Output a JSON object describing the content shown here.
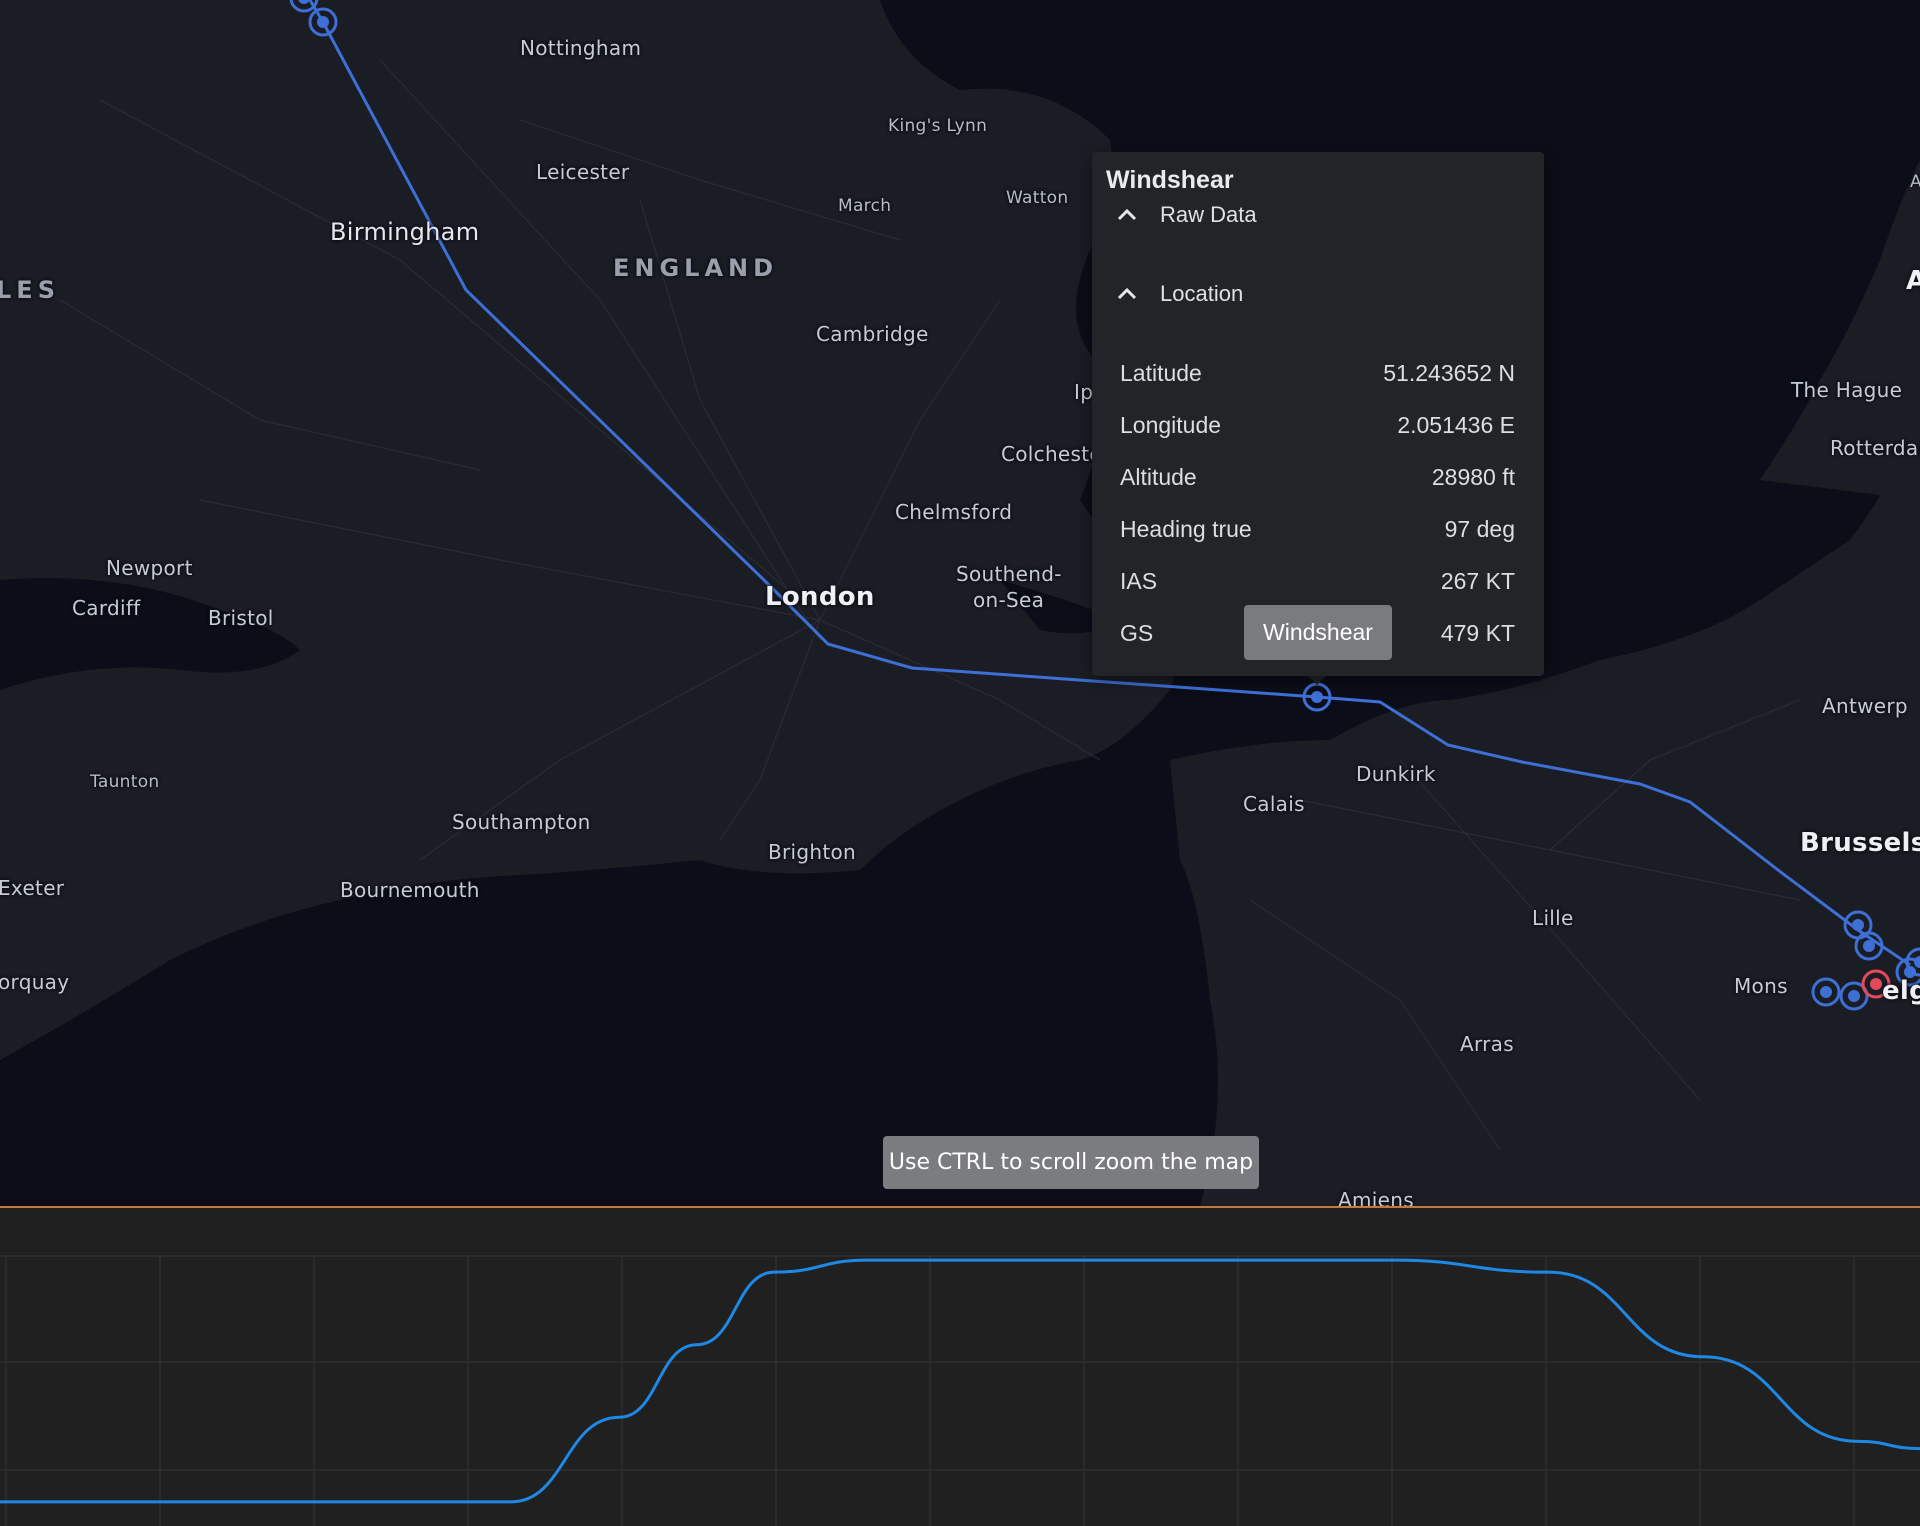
{
  "map": {
    "labels": [
      {
        "text": "Nottingham",
        "kind": "normal"
      },
      {
        "text": "King's Lynn",
        "kind": "small"
      },
      {
        "text": "Leicester",
        "kind": "normal"
      },
      {
        "text": "March",
        "kind": "small"
      },
      {
        "text": "Watton",
        "kind": "small"
      },
      {
        "text": "Birmingham",
        "kind": "medium"
      },
      {
        "text": "ENGLAND",
        "kind": "region"
      },
      {
        "text": "LES",
        "kind": "region"
      },
      {
        "text": "Cambridge",
        "kind": "normal"
      },
      {
        "text": "Ip",
        "kind": "normal"
      },
      {
        "text": "Colcheste",
        "kind": "normal"
      },
      {
        "text": "Chelmsford",
        "kind": "normal"
      },
      {
        "text": "Southend-",
        "kind": "normal"
      },
      {
        "text": "on-Sea",
        "kind": "normal"
      },
      {
        "text": "Newport",
        "kind": "normal"
      },
      {
        "text": "Cardiff",
        "kind": "normal"
      },
      {
        "text": "Bristol",
        "kind": "normal"
      },
      {
        "text": "London",
        "kind": "big"
      },
      {
        "text": "Taunton",
        "kind": "small"
      },
      {
        "text": "Southampton",
        "kind": "normal"
      },
      {
        "text": "Brighton",
        "kind": "normal"
      },
      {
        "text": "Bournemouth",
        "kind": "normal"
      },
      {
        "text": "Exeter",
        "kind": "normal"
      },
      {
        "text": "orquay",
        "kind": "normal"
      },
      {
        "text": "Calais",
        "kind": "normal"
      },
      {
        "text": "Dunkirk",
        "kind": "normal"
      },
      {
        "text": "Lille",
        "kind": "normal"
      },
      {
        "text": "Arras",
        "kind": "normal"
      },
      {
        "text": "Amiens",
        "kind": "normal"
      },
      {
        "text": "Mons",
        "kind": "normal"
      },
      {
        "text": "Brussels",
        "kind": "big"
      },
      {
        "text": "elg",
        "kind": "big"
      },
      {
        "text": "Antwerp",
        "kind": "normal"
      },
      {
        "text": "The Hague",
        "kind": "normal"
      },
      {
        "text": "Rotterdar",
        "kind": "normal"
      },
      {
        "text": "A",
        "kind": "small"
      },
      {
        "text": "A",
        "kind": "big"
      }
    ],
    "route_color": "#3d6fd6",
    "event_color": "#e2495a",
    "ctrl_hint": "Use CTRL to scroll zoom the map"
  },
  "popup": {
    "title": "Windshear",
    "sections": [
      {
        "label": "Raw Data",
        "icon": "chevron-up-icon"
      },
      {
        "label": "Location",
        "icon": "chevron-up-icon"
      }
    ],
    "fields": [
      {
        "label": "Latitude",
        "value": "51.243652 N"
      },
      {
        "label": "Longitude",
        "value": "2.051436 E"
      },
      {
        "label": "Altitude",
        "value": "28980 ft"
      },
      {
        "label": "Heading true",
        "value": "97 deg"
      },
      {
        "label": "IAS",
        "value": "267 KT"
      },
      {
        "label": "GS",
        "value": "479 KT"
      }
    ]
  },
  "marker_tooltip": "Windshear",
  "chart_data": {
    "type": "line",
    "title": "",
    "xlabel": "",
    "ylabel": "",
    "grid": true,
    "series": [
      {
        "color": "#1e88e5",
        "x": [
          0,
          3.3,
          4.0,
          4.5,
          5.0,
          5.6,
          9.0,
          10.0,
          11.0,
          12.0,
          12.4
        ],
        "y": [
          0.0,
          0.0,
          0.35,
          0.65,
          0.95,
          1.0,
          1.0,
          0.95,
          0.6,
          0.25,
          0.22
        ]
      }
    ],
    "xlim": [
      0,
      12.4
    ],
    "ylim": [
      -0.1,
      1.05
    ]
  }
}
